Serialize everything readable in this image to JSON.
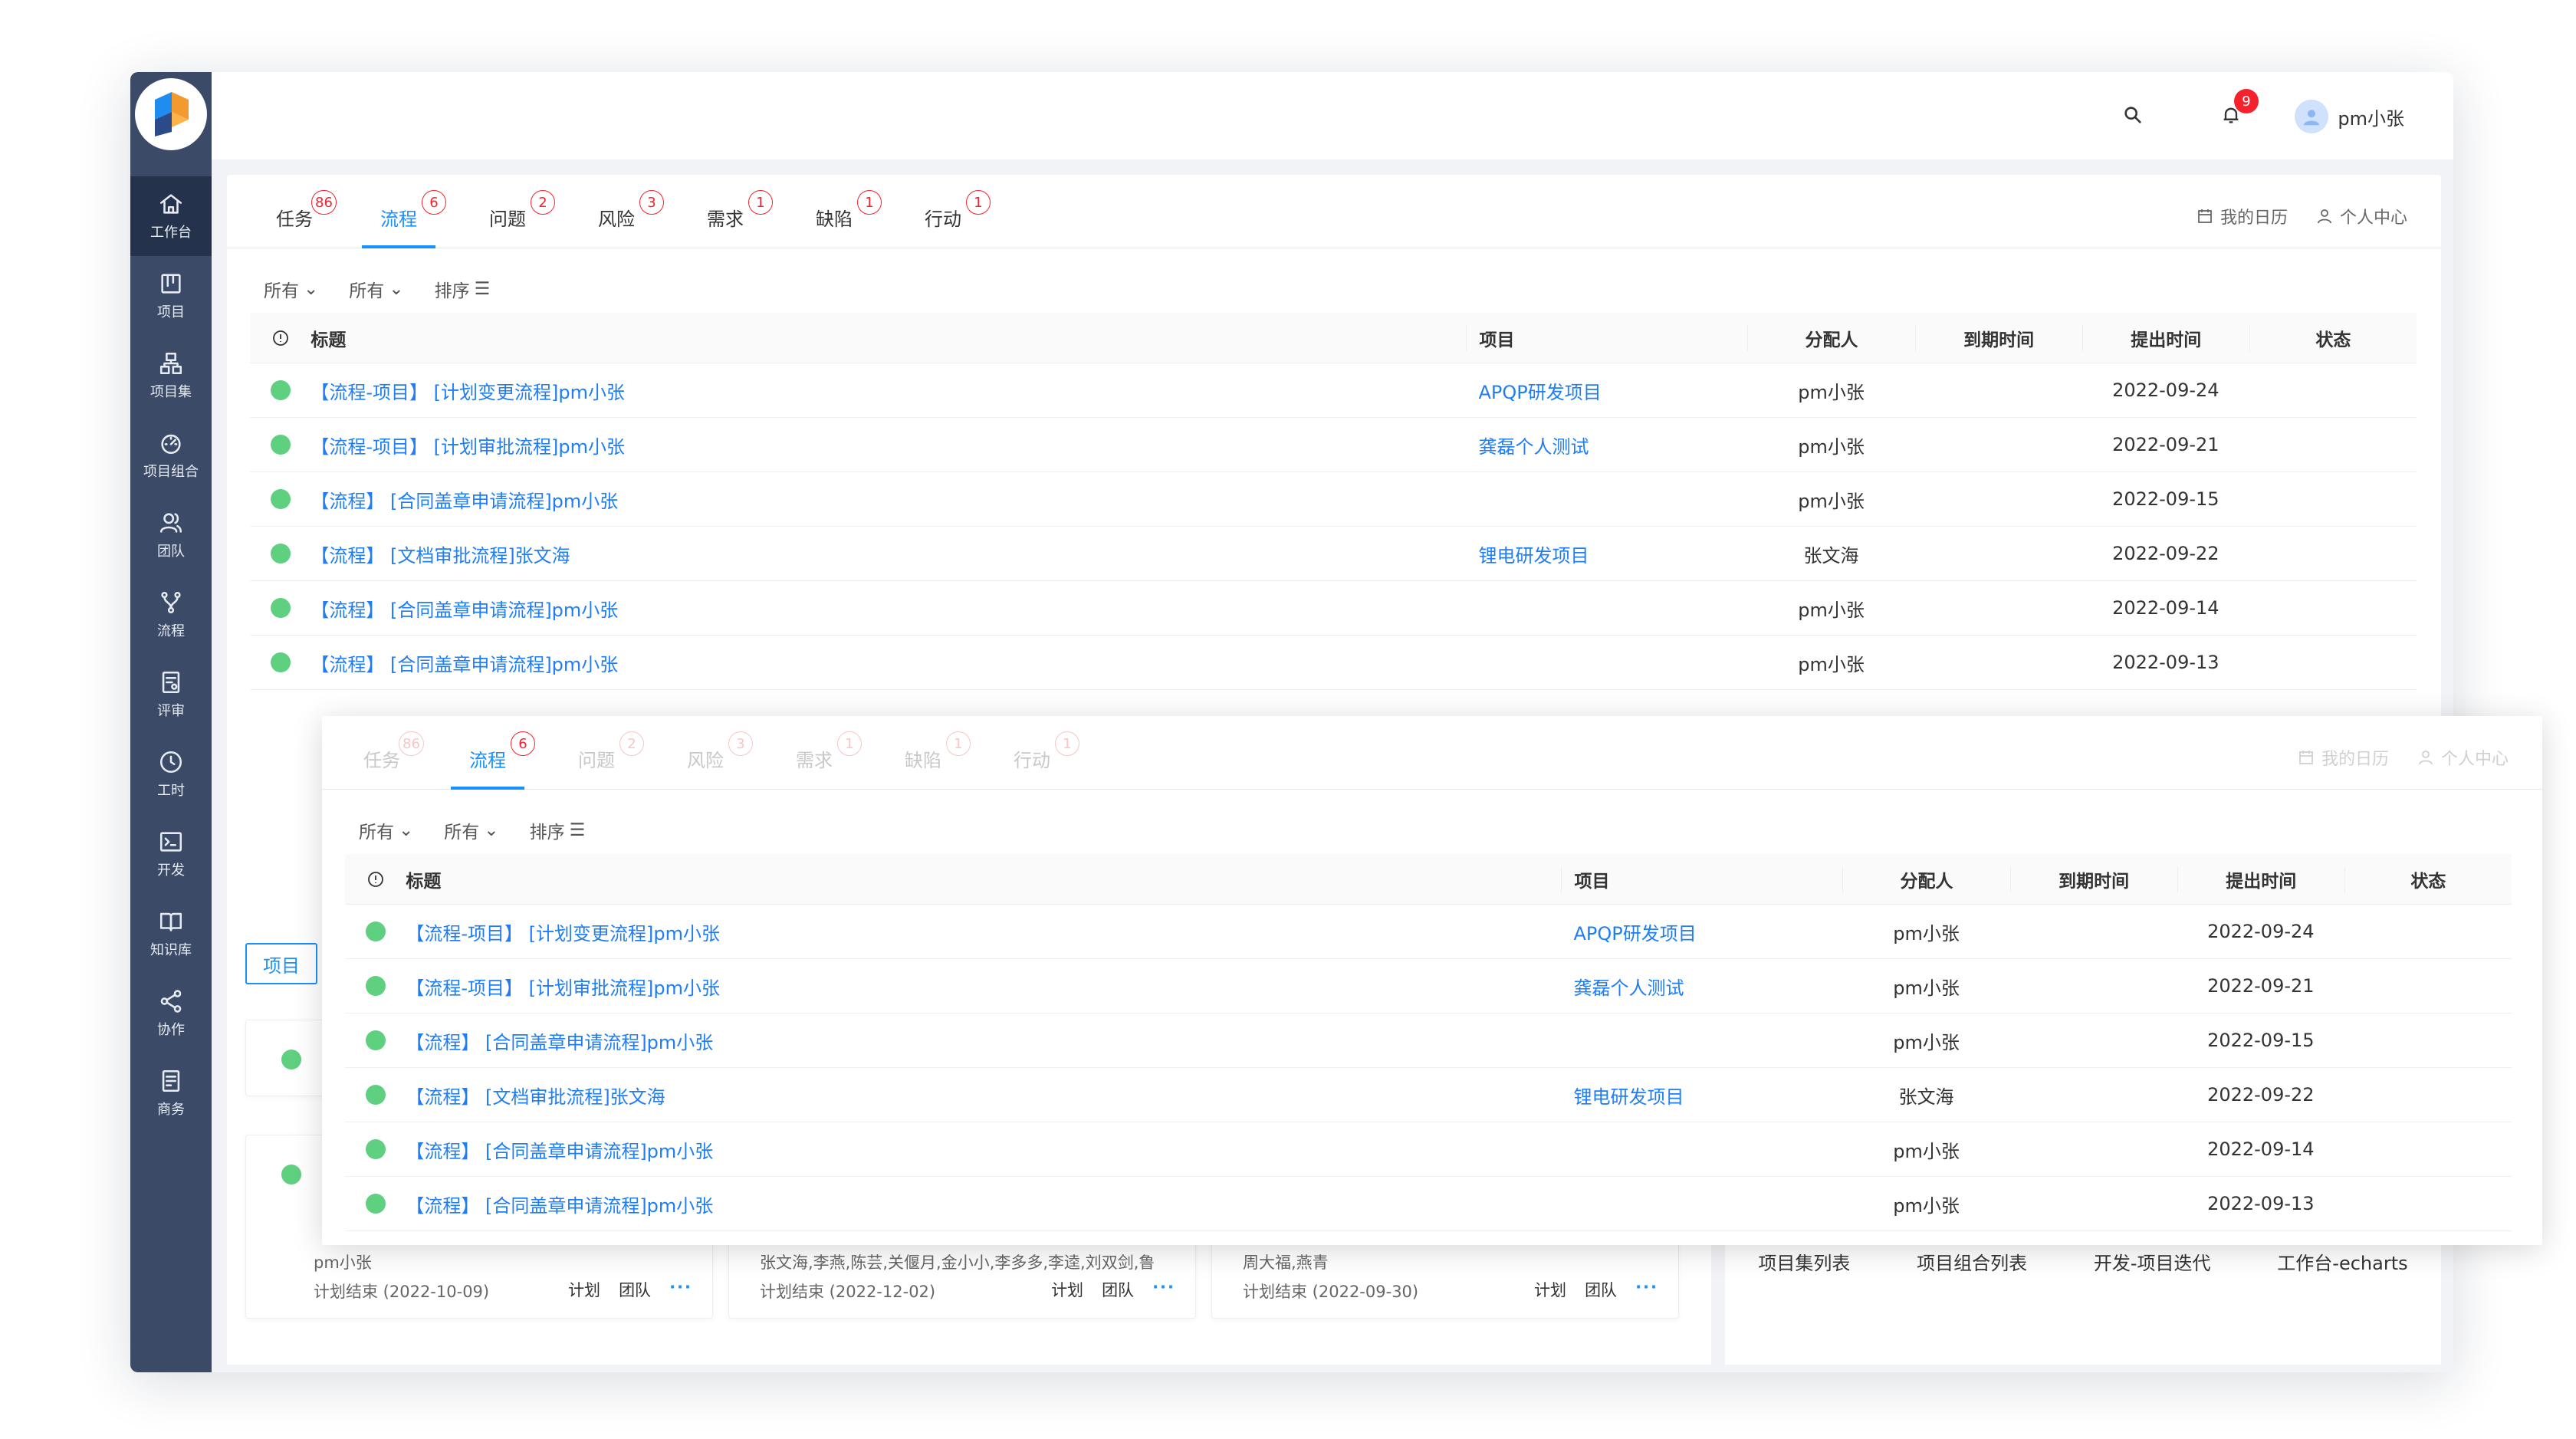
{
  "topbar": {
    "user_name": "pm小张",
    "notification_count": "9"
  },
  "sidebar": {
    "items": [
      {
        "label": "工作台",
        "icon": "home-icon"
      },
      {
        "label": "项目",
        "icon": "project-icon"
      },
      {
        "label": "项目集",
        "icon": "program-icon"
      },
      {
        "label": "项目组合",
        "icon": "portfolio-icon"
      },
      {
        "label": "团队",
        "icon": "team-icon"
      },
      {
        "label": "流程",
        "icon": "flow-icon"
      },
      {
        "label": "评审",
        "icon": "review-icon"
      },
      {
        "label": "工时",
        "icon": "clock-icon"
      },
      {
        "label": "开发",
        "icon": "terminal-icon"
      },
      {
        "label": "知识库",
        "icon": "book-icon"
      },
      {
        "label": "协作",
        "icon": "share-icon"
      },
      {
        "label": "商务",
        "icon": "business-icon"
      }
    ]
  },
  "tabs": [
    {
      "label": "任务",
      "count": "86"
    },
    {
      "label": "流程",
      "count": "6"
    },
    {
      "label": "问题",
      "count": "2"
    },
    {
      "label": "风险",
      "count": "3"
    },
    {
      "label": "需求",
      "count": "1"
    },
    {
      "label": "缺陷",
      "count": "1"
    },
    {
      "label": "行动",
      "count": "1"
    }
  ],
  "tab_links": {
    "calendar": "我的日历",
    "personal": "个人中心"
  },
  "filters": {
    "filter1": "所有",
    "filter2": "所有",
    "sort": "排序"
  },
  "table": {
    "headers": {
      "title": "标题",
      "project": "项目",
      "assignee": "分配人",
      "due": "到期时间",
      "created": "提出时间",
      "status": "状态"
    },
    "rows": [
      {
        "title": "【流程-项目】 [计划变更流程]pm小张",
        "project": "APQP研发项目",
        "assignee": "pm小张",
        "due": "",
        "created": "2022-09-24",
        "status": ""
      },
      {
        "title": "【流程-项目】 [计划审批流程]pm小张",
        "project": "龚磊个人测试",
        "assignee": "pm小张",
        "due": "",
        "created": "2022-09-21",
        "status": ""
      },
      {
        "title": "【流程】 [合同盖章申请流程]pm小张",
        "project": "",
        "assignee": "pm小张",
        "due": "",
        "created": "2022-09-15",
        "status": ""
      },
      {
        "title": "【流程】 [文档审批流程]张文海",
        "project": "锂电研发项目",
        "assignee": "张文海",
        "due": "",
        "created": "2022-09-22",
        "status": ""
      },
      {
        "title": "【流程】 [合同盖章申请流程]pm小张",
        "project": "",
        "assignee": "pm小张",
        "due": "",
        "created": "2022-09-14",
        "status": ""
      },
      {
        "title": "【流程】 [合同盖章申请流程]pm小张",
        "project": "",
        "assignee": "pm小张",
        "due": "",
        "created": "2022-09-13",
        "status": ""
      }
    ]
  },
  "projects_panel": {
    "tab_label": "项目",
    "cards": [
      {
        "owner": "pm小张",
        "meta": "计划结束 (2022-10-09)"
      },
      {
        "owner": "张文海,李燕,陈芸,关偃月,金小小,李多多,李逵,刘双剑,鲁",
        "meta": "计划结束 (2022-12-02)"
      },
      {
        "owner": "周大福,燕青",
        "meta": "计划结束 (2022-09-30)"
      }
    ],
    "actions": {
      "plan": "计划",
      "team": "团队",
      "more": "···"
    }
  },
  "shortcuts": [
    "项目集列表",
    "项目组合列表",
    "开发-项目迭代",
    "工作台-echarts"
  ],
  "colors": {
    "sidebar": "#3b4a66",
    "accent": "#1890ff",
    "badge": "#f5222d",
    "status_dot": "#5fcf80"
  }
}
